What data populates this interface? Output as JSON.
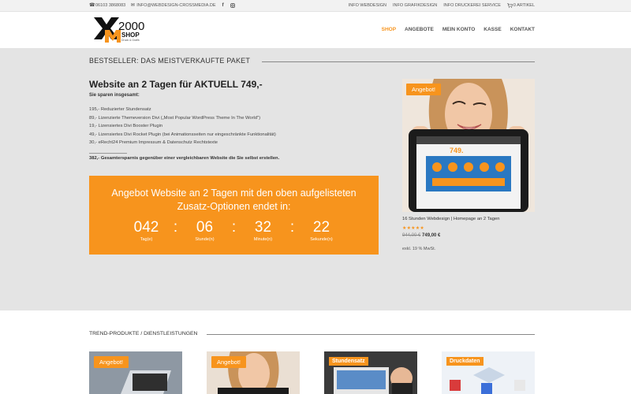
{
  "topbar": {
    "phone": "06103 3868083",
    "email": "INFO@WEBDESIGN-CROSSMEDIA.DE",
    "links": [
      "INFO WEBDESIGN",
      "INFO GRAFIKDESIGN",
      "INFO DRUCKEREI SERVICE"
    ],
    "cart": "0 ARTIKEL"
  },
  "logo": {
    "number": "2000",
    "word": "SHOP",
    "tagline": "Druck & Grafik"
  },
  "nav": [
    "SHOP",
    "ANGEBOTE",
    "MEIN KONTO",
    "KASSE",
    "KONTAKT"
  ],
  "section": {
    "title": "BESTSELLER: DAS MEISTVERKAUFTE PAKET"
  },
  "offer": {
    "heading": "Website an 2 Tagen für AKTUELL 749,-",
    "sparen": "Sie sparen insgesamt:",
    "items": [
      "195,- Reduzierter Stundensatz",
      "89,- Lizenzierte Themeversion Divi („Most Popular WordPress Theme In The World\")",
      "19,- Lizensiertes Divi Booster Plugin",
      "49,- Lizensiertes Divi Rocket Plugin (bei Animationsseiten nur eingeschränkte Funktionalität)",
      "30,- eRecht24 Premium Impressum & Datenschutz Rechtstexte"
    ],
    "summary": "382,- Gesamtersparnis gegenüber einer vergleichbaren Website die Sie selbst erstellen.",
    "box_text": "Angebot Website an 2 Tagen mit den oben aufgelisteten Zusatz-Optionen endet in:",
    "countdown": {
      "days": "042",
      "days_label": "Tag(e)",
      "hours": "06",
      "hours_label": "Stunde(n)",
      "minutes": "32",
      "minutes_label": "Minute(n)",
      "seconds": "22",
      "seconds_label": "Sekunde(n)"
    }
  },
  "product": {
    "badge": "Angebot!",
    "screen_price": "749.",
    "name": "16 Stunden Webdesign | Homepage an 2 Tagen",
    "stars": "★★★★★",
    "old_price": "944,00 €",
    "new_price": "749,00 €",
    "tax": "exkl. 19 % MwSt."
  },
  "trend": {
    "title": "TREND-PRODUKTE / DIENSTLEISTUNGEN",
    "badge1": "Angebot!",
    "badge2": "Angebot!",
    "label3": "Stundensatz",
    "label4": "Druckdaten"
  },
  "colors": {
    "accent": "#f7941d",
    "grey_bg": "#e4e4e4"
  }
}
